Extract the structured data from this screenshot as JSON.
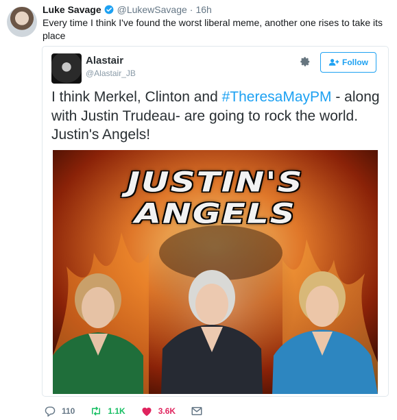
{
  "tweet": {
    "author_name": "Luke Savage",
    "author_handle": "@LukewSavage",
    "separator": "·",
    "time": "16h",
    "text": "Every time I think I've found the worst liberal meme, another one rises to take its place"
  },
  "quoted": {
    "author_name": "Alastair",
    "author_handle": "@Alastair_JB",
    "follow_label": "Follow",
    "text_before": "I think Merkel, Clinton and ",
    "hashtag": "#TheresaMayPM",
    "text_after": " - along with Justin Trudeau- are going to rock the world. Justin's Angels!",
    "image": {
      "title_line1": "JUSTIN'S",
      "title_line2": "ANGELS"
    }
  },
  "actions": {
    "replies": "110",
    "retweets": "1.1K",
    "likes": "3.6K"
  },
  "colors": {
    "accent": "#1da1f2",
    "retweet": "#17bf63",
    "like": "#e0245e",
    "muted": "#657786"
  },
  "icons": [
    "reply-icon",
    "retweet-icon",
    "like-icon",
    "message-icon",
    "verified-icon",
    "gear-icon",
    "follow-user-icon"
  ]
}
